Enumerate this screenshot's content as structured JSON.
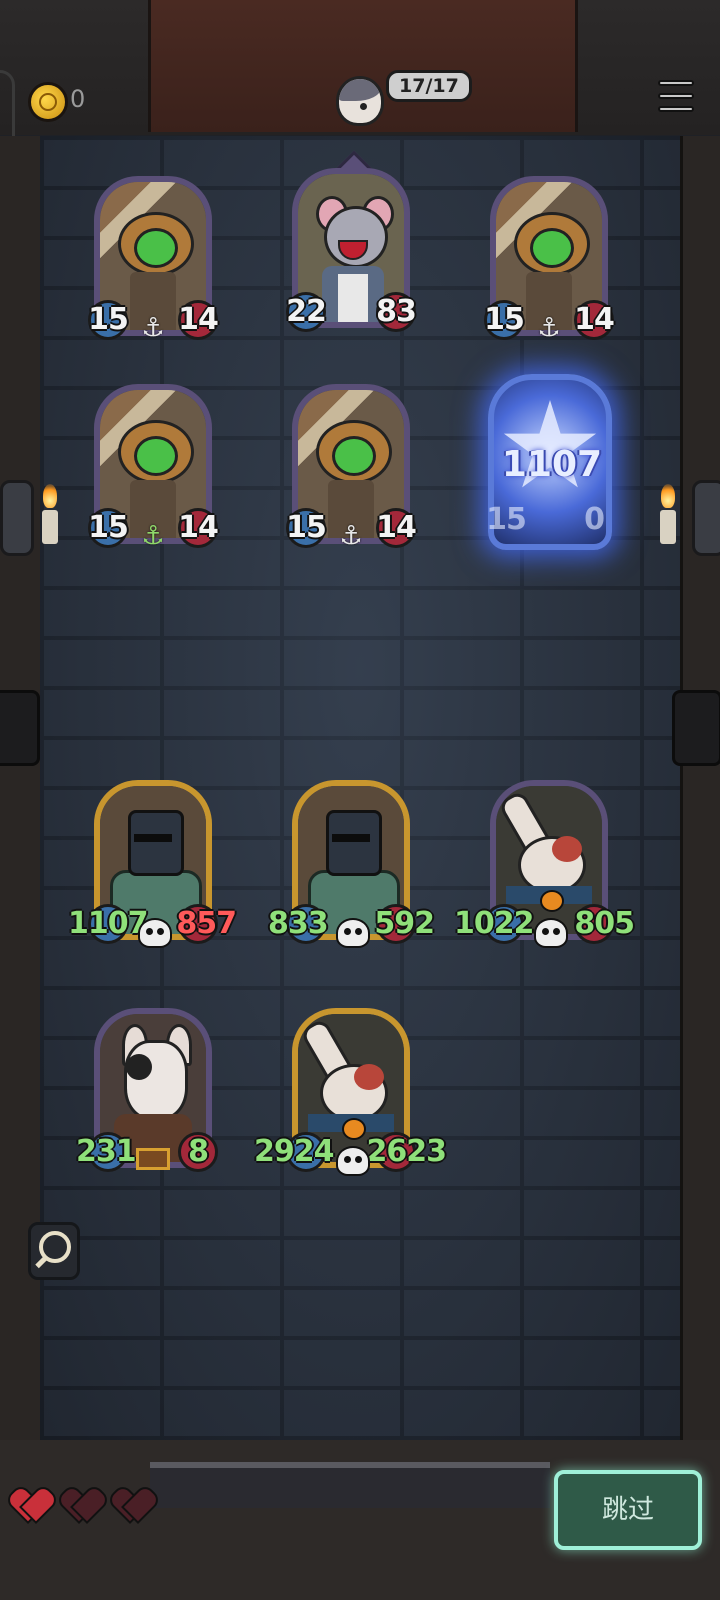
{
  "header": {
    "coins": "0",
    "counter": "17/17"
  },
  "enemies": [
    {
      "atk": "15",
      "hp": "14",
      "type": "plant",
      "icon": "anchor-icon"
    },
    {
      "atk": "22",
      "hp": "83",
      "type": "rat",
      "icon": "none"
    },
    {
      "atk": "15",
      "hp": "14",
      "type": "plant",
      "icon": "anchor-icon"
    },
    {
      "atk": "15",
      "hp": "14",
      "type": "plant",
      "icon": "anchor-icon-green"
    },
    {
      "atk": "15",
      "hp": "14",
      "type": "plant",
      "icon": "anchor-icon"
    },
    {
      "atk": "15",
      "hp": "0",
      "type": "plant",
      "icon": "anchor-icon",
      "effect_value": "1107",
      "highlighted": true
    }
  ],
  "allies": [
    {
      "atk": "1107",
      "hp": "857",
      "type": "knight",
      "frame": "gold"
    },
    {
      "atk": "833",
      "hp": "592",
      "type": "knight",
      "frame": "gold"
    },
    {
      "atk": "1022",
      "hp": "805",
      "type": "rabbit",
      "frame": "purple"
    },
    {
      "atk": "231",
      "hp": "8",
      "type": "dog",
      "frame": "purple"
    },
    {
      "atk": "2924",
      "hp": "2623",
      "type": "rabbit",
      "frame": "gold"
    }
  ],
  "footer": {
    "lives_full": 1,
    "lives_total": 3,
    "skip_label": "跳过"
  },
  "colors": {
    "atk": "#3a6fa8",
    "hp": "#a3283a",
    "ally_number": "#8fe07a",
    "skip_button": "#2f5a48"
  }
}
